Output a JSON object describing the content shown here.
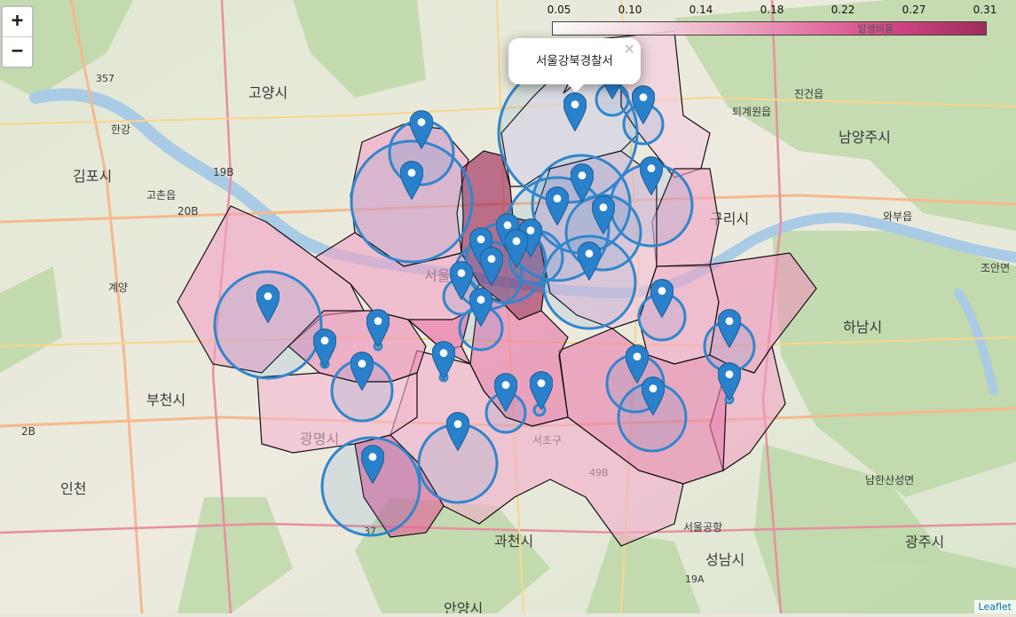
{
  "zoom": {
    "in_label": "+",
    "out_label": "−"
  },
  "legend": {
    "ticks": [
      "0.05",
      "0.10",
      "0.14",
      "0.18",
      "0.22",
      "0.27",
      "0.31"
    ],
    "caption": "발생비율",
    "min": 0.05,
    "max": 0.31,
    "low_color": "#ffffff",
    "high_color": "#9a1b52"
  },
  "popup": {
    "text": "서울강북경찰서",
    "close": "×"
  },
  "attribution": "Leaflet",
  "marker_color": "#2a81cb",
  "circle_color": "#3186cc",
  "map_labels": [
    "고양시",
    "김포시",
    "고촌읍",
    "부천시",
    "인천",
    "광명시",
    "과천시",
    "안양시",
    "성남시",
    "광주시",
    "하남시",
    "구리시",
    "남양주시",
    "진건읍",
    "퇴계원읍",
    "와부읍",
    "조안면",
    "남한산성면",
    "계양",
    "서울",
    "서울공항",
    "서초구",
    "한강",
    "357",
    "19B",
    "20B",
    "2B",
    "37",
    "49B",
    "19A"
  ]
}
